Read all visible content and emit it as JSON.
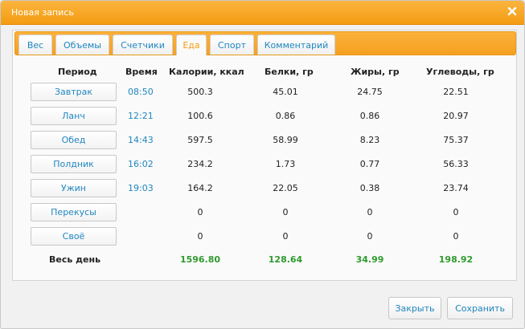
{
  "dialog": {
    "title": "Новая запись"
  },
  "tabs": [
    {
      "label": "Вес"
    },
    {
      "label": "Объемы"
    },
    {
      "label": "Счетчики"
    },
    {
      "label": "Еда",
      "active": true
    },
    {
      "label": "Спорт"
    },
    {
      "label": "Комментарий"
    }
  ],
  "table": {
    "headers": {
      "period": "Период",
      "time": "Время",
      "calories": "Калории, ккал",
      "proteins": "Белки, гр",
      "fats": "Жиры, гр",
      "carbs": "Углеводы, гр"
    },
    "rows": [
      {
        "meal": "Завтрак",
        "time": "08:50",
        "calories": "500.3",
        "proteins": "45.01",
        "fats": "24.75",
        "carbs": "22.51"
      },
      {
        "meal": "Ланч",
        "time": "12:21",
        "calories": "100.6",
        "proteins": "0.86",
        "fats": "0.86",
        "carbs": "20.97"
      },
      {
        "meal": "Обед",
        "time": "14:43",
        "calories": "597.5",
        "proteins": "58.99",
        "fats": "8.23",
        "carbs": "75.37"
      },
      {
        "meal": "Полдник",
        "time": "16:02",
        "calories": "234.2",
        "proteins": "1.73",
        "fats": "0.77",
        "carbs": "56.33"
      },
      {
        "meal": "Ужин",
        "time": "19:03",
        "calories": "164.2",
        "proteins": "22.05",
        "fats": "0.38",
        "carbs": "23.74"
      },
      {
        "meal": "Перекусы",
        "time": "",
        "calories": "0",
        "proteins": "0",
        "fats": "0",
        "carbs": "0"
      },
      {
        "meal": "Своё",
        "time": "",
        "calories": "0",
        "proteins": "0",
        "fats": "0",
        "carbs": "0"
      }
    ],
    "total": {
      "label": "Весь день",
      "calories": "1596.80",
      "proteins": "128.64",
      "fats": "34.99",
      "carbs": "198.92"
    }
  },
  "footer": {
    "close_label": "Закрыть",
    "save_label": "Сохранить"
  },
  "colors": {
    "accent": "#f39c12",
    "link": "#1f86c0",
    "total": "#2e9a2e"
  },
  "icons": {
    "close": "close-icon"
  }
}
